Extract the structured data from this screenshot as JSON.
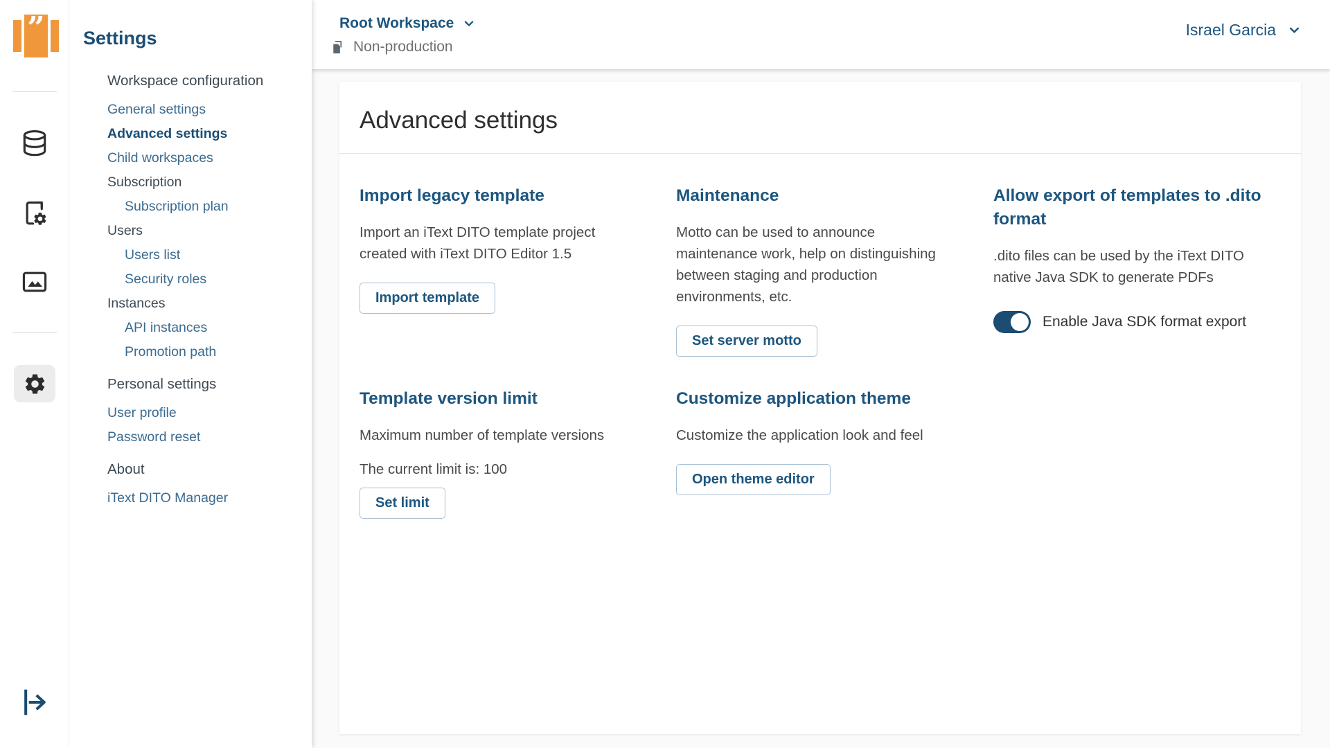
{
  "colors": {
    "brand_orange": "#F0973C",
    "heading_blue": "#1C567F",
    "link_blue": "#3A6B90",
    "active_blue": "#1B4E75",
    "toggle_on": "#1B4C72",
    "body_text": "#4A4A4A"
  },
  "rail": {
    "icons": [
      "database-icon",
      "template-settings-icon",
      "images-icon",
      "settings-gear-icon",
      "logout-icon"
    ],
    "active_icon": "settings-gear-icon"
  },
  "sidebar": {
    "title": "Settings",
    "items": [
      {
        "label": "Workspace configuration",
        "type": "header"
      },
      {
        "label": "General settings",
        "type": "link"
      },
      {
        "label": "Advanced settings",
        "type": "active"
      },
      {
        "label": "Child workspaces",
        "type": "link"
      },
      {
        "label": "Subscription",
        "type": "group"
      },
      {
        "label": "Subscription plan",
        "type": "link-indented"
      },
      {
        "label": "Users",
        "type": "group"
      },
      {
        "label": "Users list",
        "type": "link-indented"
      },
      {
        "label": "Security roles",
        "type": "link-indented"
      },
      {
        "label": "Instances",
        "type": "group"
      },
      {
        "label": "API instances",
        "type": "link-indented"
      },
      {
        "label": "Promotion path",
        "type": "link-indented"
      },
      {
        "label": "Personal settings",
        "type": "header"
      },
      {
        "label": "User profile",
        "type": "link"
      },
      {
        "label": "Password reset",
        "type": "link"
      },
      {
        "label": "About",
        "type": "header"
      },
      {
        "label": "iText DITO Manager",
        "type": "link"
      }
    ]
  },
  "topbar": {
    "workspace_selector": "Root Workspace",
    "environment": "Non-production",
    "user_menu": "Israel Garcia"
  },
  "main": {
    "title": "Advanced settings",
    "sections": [
      {
        "title": "Import legacy template",
        "description": "Import an iText DITO template project created with iText DITO Editor 1.5",
        "button": "Import template"
      },
      {
        "title": "Maintenance",
        "description": "Motto can be used to announce maintenance work, help on distinguishing between staging and production environments, etc.",
        "button": "Set server motto"
      },
      {
        "title": "Allow export of templates to .dito format",
        "description": ".dito files can be used by the iText DITO native Java SDK to generate PDFs",
        "toggle_label": "Enable Java SDK format export",
        "toggle_state": "on"
      },
      {
        "title": "Template version limit",
        "description": "Maximum number of template versions",
        "current_limit": "The current limit is: 100",
        "button": "Set limit"
      },
      {
        "title": "Customize application theme",
        "description": "Customize the application look and feel",
        "button": "Open theme editor"
      }
    ]
  }
}
